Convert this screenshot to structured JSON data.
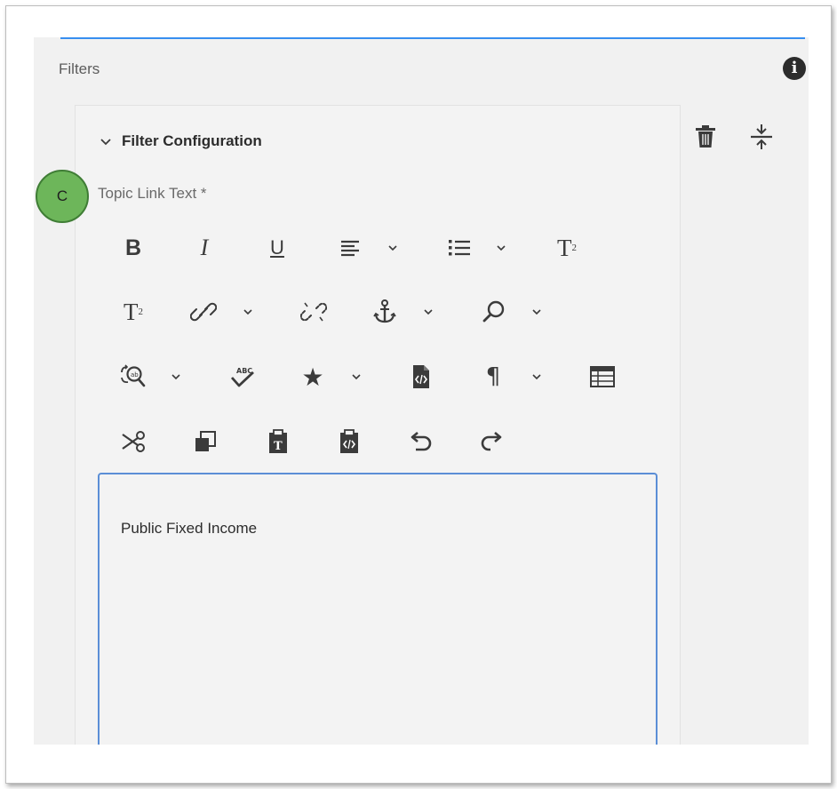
{
  "panel": {
    "title": "Filters",
    "info_icon": "info-icon"
  },
  "filter_configuration": {
    "header": "Filter Configuration",
    "delete_icon": "trash-icon",
    "collapse_icon": "collapse-icon"
  },
  "annotation_badge": {
    "label": "C",
    "color": "#6db65a"
  },
  "field": {
    "label": "Topic Link Text *",
    "value": "Public Fixed Income"
  },
  "toolbar": {
    "row1": [
      "bold",
      "italic",
      "underline",
      "align",
      "list",
      "subscript"
    ],
    "row2": [
      "superscript",
      "link",
      "unlink",
      "anchor",
      "find"
    ],
    "row3": [
      "find-replace",
      "spellcheck",
      "special-characters",
      "source-edit",
      "paragraph-format",
      "table"
    ],
    "row4": [
      "cut",
      "copy",
      "paste-plain-text",
      "paste-from-word",
      "undo",
      "redo"
    ],
    "bold_glyph": "B",
    "italic_glyph": "I",
    "underline_glyph": "U",
    "subscript_glyph": "T",
    "subscript_mark": "2",
    "superscript_glyph": "T",
    "superscript_mark": "2",
    "star_glyph": "★",
    "paragraph_glyph": "¶"
  },
  "colors": {
    "accent_blue": "#378ef0",
    "editor_border": "#5b8ed6",
    "panel_bg": "#f1f1f1"
  }
}
